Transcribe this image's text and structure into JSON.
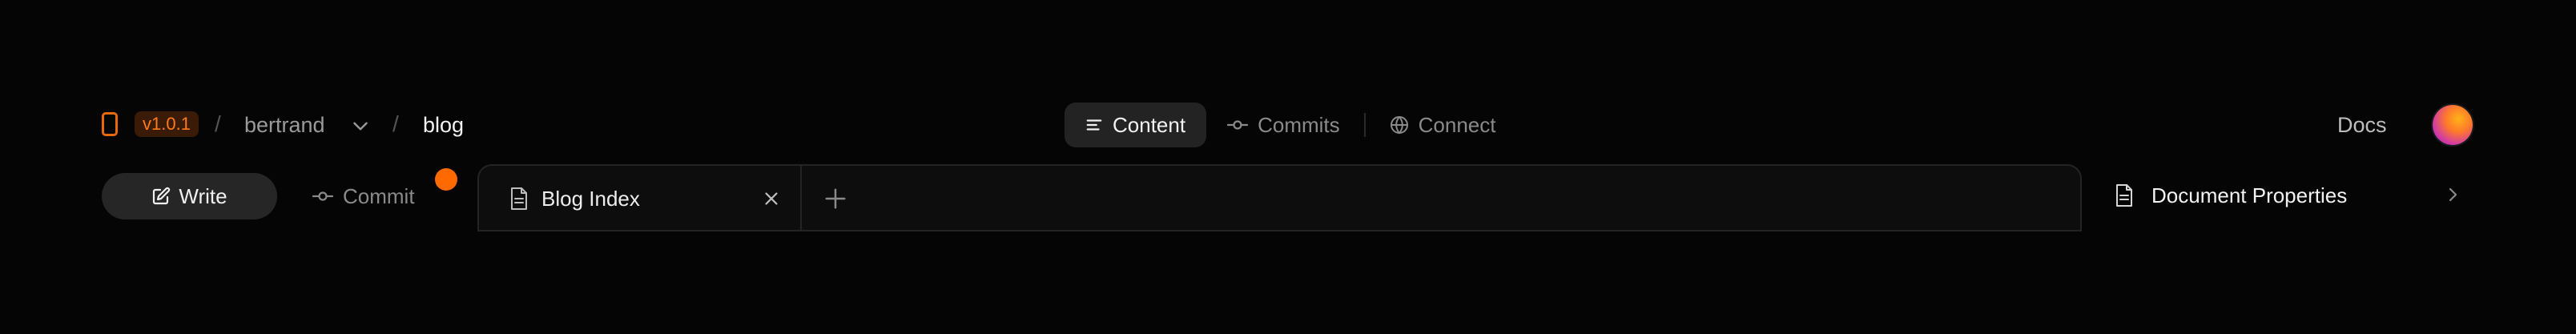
{
  "header": {
    "brand_icon": "notebook-icon",
    "version": "v1.0.1",
    "breadcrumb": {
      "separator": "/",
      "owner": "bertrand",
      "project": "blog"
    },
    "nav": {
      "items": [
        {
          "label": "Content",
          "icon": "align-left-icon",
          "active": true
        },
        {
          "label": "Commits",
          "icon": "git-commit-icon",
          "active": false
        },
        {
          "label": "Connect",
          "icon": "globe-icon",
          "active": false
        }
      ]
    },
    "docs_label": "Docs",
    "avatar_icon": "user-avatar"
  },
  "toolbar": {
    "write_label": "Write",
    "commit_label": "Commit",
    "commit_indicator_color": "#ff6a00"
  },
  "editor": {
    "tabs": [
      {
        "label": "Blog Index",
        "icon": "file-text-icon"
      }
    ],
    "add_tab_icon": "plus-icon"
  },
  "side_panel": {
    "label": "Document Properties",
    "icon": "file-text-icon",
    "chevron": "chevron-right-icon"
  },
  "colors": {
    "background": "#050505",
    "accent": "#ff6a00",
    "badge_bg": "#3a1b08",
    "badge_text": "#ff7a1a"
  }
}
